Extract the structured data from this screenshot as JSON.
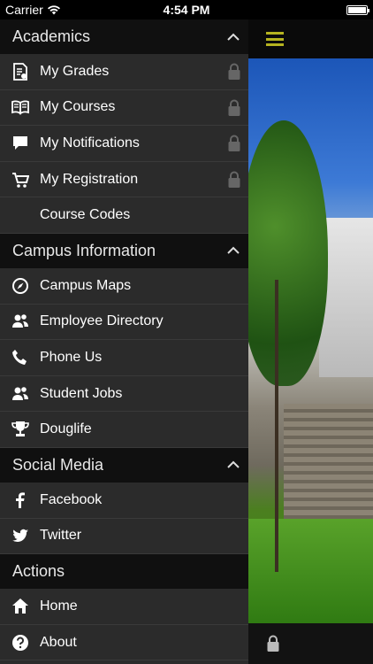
{
  "status_bar": {
    "carrier": "Carrier",
    "time": "4:54 PM"
  },
  "sections": [
    {
      "title": "Academics",
      "items": [
        {
          "label": "My Grades",
          "icon": "grades-icon",
          "locked": true
        },
        {
          "label": "My Courses",
          "icon": "book-icon",
          "locked": true
        },
        {
          "label": "My Notifications",
          "icon": "chat-bubble-icon",
          "locked": true
        },
        {
          "label": "My Registration",
          "icon": "cart-icon",
          "locked": true
        },
        {
          "label": "Course Codes",
          "icon": "",
          "locked": false
        }
      ]
    },
    {
      "title": "Campus Information",
      "items": [
        {
          "label": "Campus Maps",
          "icon": "compass-icon"
        },
        {
          "label": "Employee Directory",
          "icon": "people-icon"
        },
        {
          "label": "Phone Us",
          "icon": "phone-icon"
        },
        {
          "label": "Student Jobs",
          "icon": "people-icon"
        },
        {
          "label": "Douglife",
          "icon": "trophy-icon"
        }
      ]
    },
    {
      "title": "Social Media",
      "items": [
        {
          "label": "Facebook",
          "icon": "facebook-icon"
        },
        {
          "label": "Twitter",
          "icon": "twitter-icon"
        }
      ]
    },
    {
      "title": "Actions",
      "items": [
        {
          "label": "Home",
          "icon": "home-icon"
        },
        {
          "label": "About",
          "icon": "help-icon"
        }
      ]
    }
  ],
  "colors": {
    "accent": "#b5b320",
    "sidebar_bg": "#2b2b2b",
    "header_bg": "#101010"
  }
}
